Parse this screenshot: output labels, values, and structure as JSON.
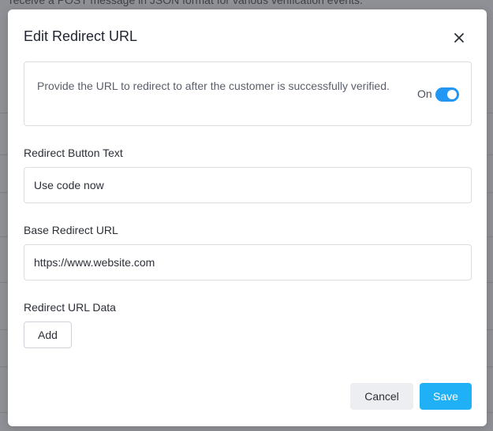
{
  "background": {
    "top_text": "receive a POST message in JSON format for various verification events."
  },
  "modal": {
    "title": "Edit Redirect URL",
    "close_icon": "close-icon",
    "info": {
      "text": "Provide the URL to redirect to after the customer is successfully verified.",
      "toggle_label": "On",
      "toggle_on": true,
      "toggle_color": "#2196f3"
    },
    "fields": {
      "redirect_button_text": {
        "label": "Redirect Button Text",
        "value": "Use code now"
      },
      "base_redirect_url": {
        "label": "Base Redirect URL",
        "value": "https://www.website.com"
      },
      "redirect_url_data": {
        "label": "Redirect URL Data",
        "add_label": "Add"
      }
    },
    "footer": {
      "cancel_label": "Cancel",
      "save_label": "Save",
      "save_color": "#1fb0f5"
    }
  }
}
